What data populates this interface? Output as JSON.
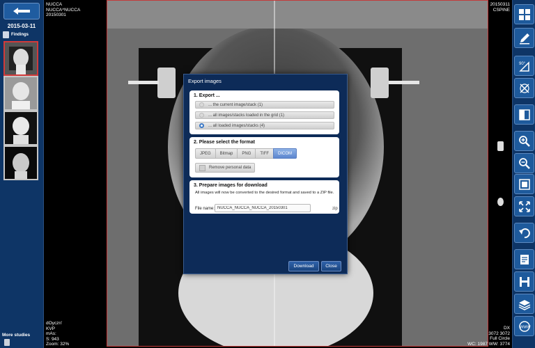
{
  "left_panel": {
    "study_date": "2015-03-11",
    "findings_label": "Findings",
    "more_studies_label": "More studies"
  },
  "overlay": {
    "top_left": [
      "NUCCA",
      "NUCCA^NUCCA",
      "20150301"
    ],
    "top_right": [
      "20150311",
      "CSPINE"
    ],
    "bottom_left": [
      "dOyczn'",
      "KVP",
      "mAs:",
      "S: 943",
      "Zoom: 32%"
    ],
    "bottom_right": [
      "DX",
      "3072 3072",
      "Full Circle",
      "WC: 1987 WW: 3774"
    ]
  },
  "dialog": {
    "title": "Export images",
    "export_section": {
      "heading": "1. Export ...",
      "options": [
        {
          "label": "... the current image/stack (1)",
          "selected": false
        },
        {
          "label": "... all images/stacks loaded in the grid (1)",
          "selected": false
        },
        {
          "label": "... all loaded images/stacks (4)",
          "selected": true
        }
      ]
    },
    "format_section": {
      "heading": "2. Please select the format",
      "formats": [
        "JPEG",
        "Bitmap",
        "PNG",
        "TIFF",
        "DICOM"
      ],
      "selected_format": "DICOM",
      "remove_personal_label": "Remove personal data"
    },
    "prepare_section": {
      "heading": "3. Prepare images for download",
      "description": "All images will now be converted to the desired format and saved to a ZIP file.",
      "file_name_label": "File name:",
      "file_name_value": "NUCCA_NUCCA_NUCCA_20150301",
      "file_suffix": "zip"
    },
    "download_label": "Download",
    "close_label": "Close"
  },
  "toolbar": {
    "tools": [
      "grid-icon",
      "pen-icon",
      "rotate-90-icon",
      "flip-icon",
      "split-view-icon",
      "zoom-in-icon",
      "zoom-out-icon",
      "fit-screen-icon",
      "fullscreen-icon",
      "undo-icon",
      "report-icon",
      "save-icon",
      "layers-icon",
      "web-icon"
    ],
    "tool_label_rotate": "90°",
    "tool_label_web": "WWW"
  },
  "colors": {
    "panel_bg": "#0e3566",
    "dialog_bg": "#0d2b58",
    "accent": "#5c86cf",
    "frame_border": "#c43a3a"
  }
}
